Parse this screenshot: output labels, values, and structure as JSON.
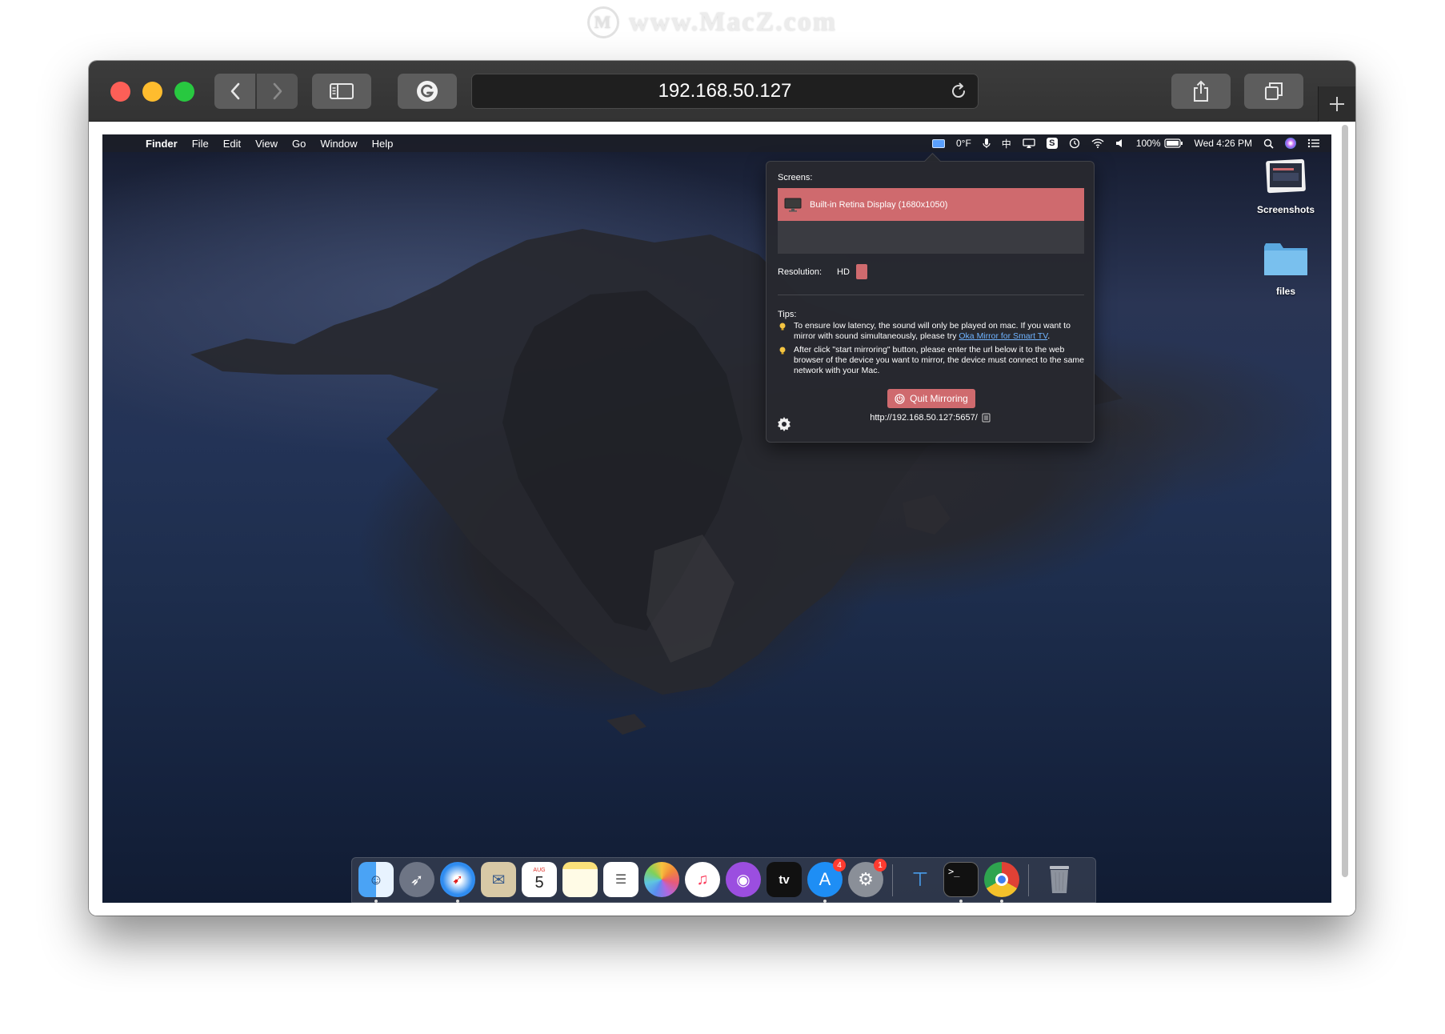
{
  "watermark": {
    "text": "www.MacZ.com",
    "logo": "M"
  },
  "browser": {
    "url": "192.168.50.127",
    "icons": {
      "back": "chevron-left-icon",
      "forward": "chevron-right-icon",
      "sidebar": "sidebar-icon",
      "extension": "grammarly-icon",
      "reload": "reload-icon",
      "share": "share-icon",
      "tabs": "tabs-overview-icon",
      "new_tab": "plus-icon"
    },
    "traffic_lights": [
      "#fd5f57",
      "#febc2e",
      "#28c840"
    ]
  },
  "menubar": {
    "apple": "",
    "app": "Finder",
    "items": [
      "File",
      "Edit",
      "View",
      "Go",
      "Window",
      "Help"
    ],
    "status": {
      "temperature": "0°F",
      "input": "中",
      "battery": "100%",
      "clock": "Wed 4:26 PM"
    }
  },
  "popover": {
    "screens_label": "Screens:",
    "screen_name": "Built-in Retina Display (1680x1050)",
    "resolution_label": "Resolution:",
    "resolution_value": "HD",
    "tips_label": "Tips:",
    "tip1_before": "To ensure low latency, the sound will only be played on mac. If you want to mirror with sound simultaneously, please try ",
    "tip1_link": "Oka Mirror for Smart TV",
    "tip1_after": ".",
    "tip2": "After click \"start mirroring\" button, please enter the url below it to the web browser of the device you want to mirror, the device must connect to the same network with your Mac.",
    "quit_button": "Quit Mirroring",
    "mirror_url": "http://192.168.50.127:5657/"
  },
  "desktop_icons": [
    {
      "label": "Screenshots"
    },
    {
      "label": "files"
    }
  ],
  "dock": {
    "apps": [
      "finder",
      "launchpad",
      "safari",
      "mail",
      "calendar",
      "notes",
      "reminders",
      "photos",
      "music",
      "podcasts",
      "apple-tv",
      "app-store",
      "system-preferences",
      "keynote",
      "terminal",
      "chrome",
      "trash"
    ],
    "calendar_month": "AUG",
    "calendar_day": "5",
    "appstore_badge": "4",
    "sysprefs_badge": "1",
    "tv_label": "tv"
  },
  "colors": {
    "accent": "#cf6a6e",
    "link": "#6fb3ff"
  }
}
